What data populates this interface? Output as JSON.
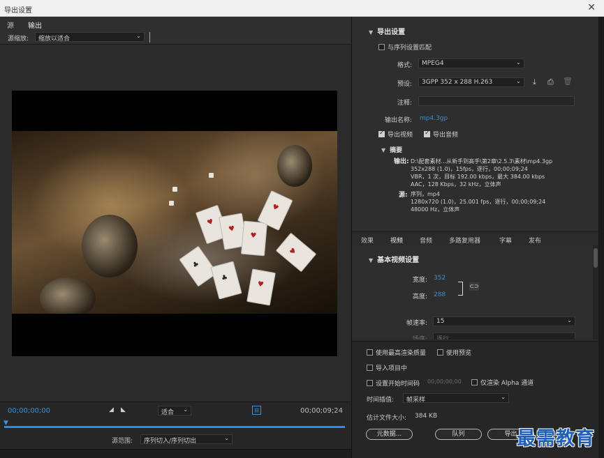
{
  "window": {
    "title": "导出设置",
    "close": "✕"
  },
  "left": {
    "tabs": [
      {
        "label": "源"
      },
      {
        "label": "输出"
      }
    ],
    "zoom": {
      "label": "源缩放:",
      "value": "缩放以适合"
    },
    "timecode_start": "00;00;00;00",
    "timecode_end": "00;00;09;24",
    "fit": "适合",
    "range": {
      "label": "源范围:",
      "value": "序列切入/序列切出"
    }
  },
  "export": {
    "title": "导出设置",
    "match_sequence": "与序列设置匹配",
    "format_label": "格式:",
    "format": "MPEG4",
    "preset_label": "预设:",
    "preset": "3GPP 352 x 288 H.263",
    "note_label": "注释:",
    "output_name_label": "输出名称:",
    "output_name": "mp4.3gp",
    "export_video": "导出视频",
    "export_audio": "导出音频",
    "summary_title": "摘要",
    "output_key": "输出:",
    "output_lines": [
      "D:\\配套素材...从新手到高手\\第2章\\2.5.3\\素材\\mp4.3gp",
      "352x288 (1.0)，15fps，逐行，00;00;09;24",
      "VBR，1 次，目标 192.00 kbps，最大 384.00 kbps",
      "AAC，128 Kbps，32  kHz，立体声"
    ],
    "source_key": "源:",
    "source_lines": [
      "序列，mp4",
      "1280x720 (1.0)，25.001 fps，逐行，00;00;09;24",
      "48000 Hz，立体声"
    ]
  },
  "video_tabs": [
    "效果",
    "视频",
    "音频",
    "多路复用器",
    "字幕",
    "发布"
  ],
  "basic_video": {
    "title": "基本视频设置",
    "width_label": "宽度:",
    "width": "352",
    "height_label": "高度:",
    "height": "288",
    "framerate_label": "帧速率:",
    "framerate": "15",
    "field_label": "场序:",
    "field_value": "逐行"
  },
  "options": {
    "max_quality": "使用最高渲染质量",
    "use_preview": "使用预览",
    "import_project": "导入项目中",
    "set_start_tc": "设置开始时间码",
    "start_tc_value": "00;00;00;00",
    "alpha_only": "仅渲染 Alpha 通道",
    "interp_label": "时间插值:",
    "interp_value": "帧采样",
    "filesize_label": "估计文件大小:",
    "filesize": "384 KB"
  },
  "buttons": {
    "metadata": "元数据...",
    "queue": "队列",
    "export": "导出"
  },
  "watermark": "最需教育"
}
